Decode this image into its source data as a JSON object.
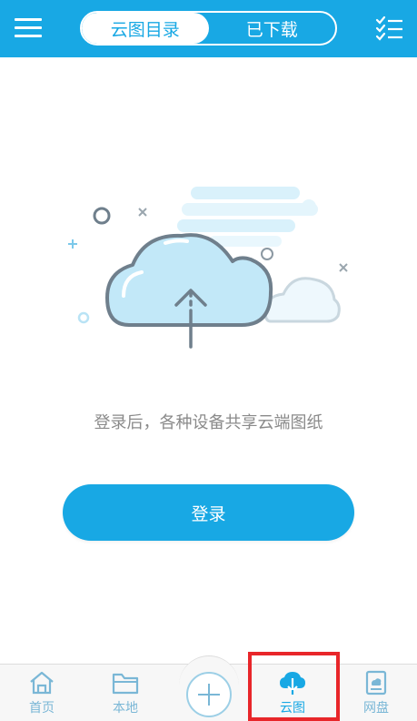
{
  "header": {
    "tabs": [
      {
        "label": "云图目录",
        "active": true
      },
      {
        "label": "已下载",
        "active": false
      }
    ],
    "menu_icon": "hamburger-menu-icon",
    "list_icon": "checklist-icon"
  },
  "main": {
    "illustration_icon": "cloud-upload-illustration",
    "description": "登录后，各种设备共享云端图纸",
    "login_label": "登录"
  },
  "bottom_nav": {
    "items": [
      {
        "label": "首页",
        "icon": "home-icon"
      },
      {
        "label": "本地",
        "icon": "folder-icon"
      },
      {
        "label": "云图",
        "icon": "cloud-download-icon",
        "active": true
      },
      {
        "label": "网盘",
        "icon": "disk-icon"
      }
    ],
    "add_icon": "plus-icon"
  },
  "colors": {
    "brand": "#18a8e4",
    "nav_inactive": "#7ab7d6",
    "highlight": "#e8262a"
  }
}
